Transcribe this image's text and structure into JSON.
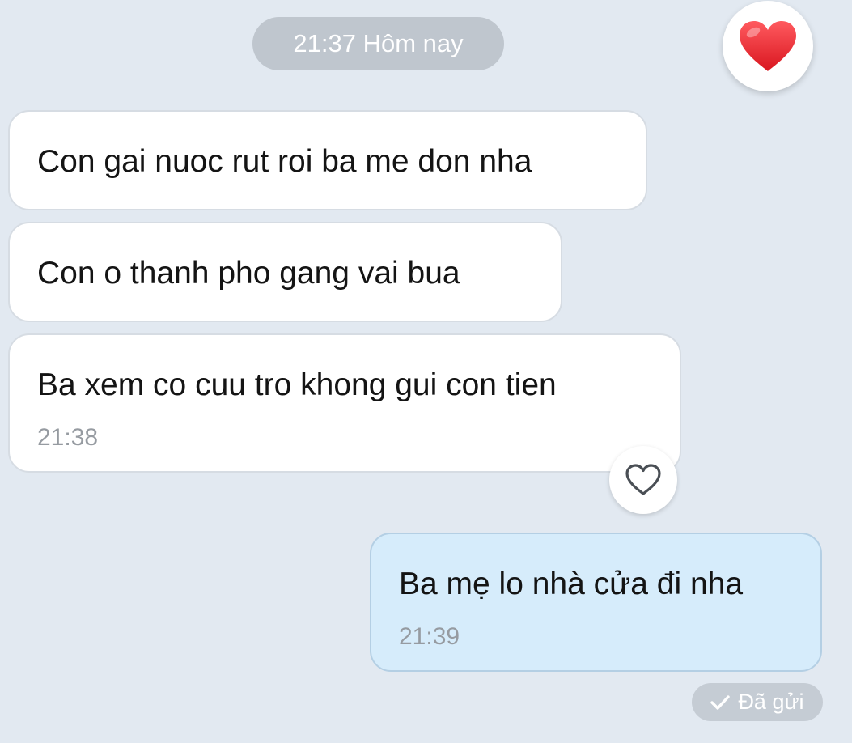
{
  "chat": {
    "date_separator": "21:37 Hôm nay",
    "messages": [
      {
        "direction": "incoming",
        "text": "Con gai nuoc rut roi ba me don nha"
      },
      {
        "direction": "incoming",
        "text": "Con o thanh pho gang vai bua"
      },
      {
        "direction": "incoming",
        "text": "Ba xem co cuu tro khong gui con tien",
        "time": "21:38"
      },
      {
        "direction": "outgoing",
        "text": "Ba mẹ lo nhà cửa đi nha",
        "time": "21:39"
      }
    ],
    "status": "Đã gửi"
  },
  "icons": {
    "top_reaction": "red-heart-icon",
    "react_button": "heart-outline-icon",
    "status": "checkmark-icon"
  },
  "colors": {
    "background": "#e2e9f1",
    "incoming_bubble": "#ffffff",
    "outgoing_bubble": "#d6ecfb",
    "heart": "#e0252f"
  }
}
